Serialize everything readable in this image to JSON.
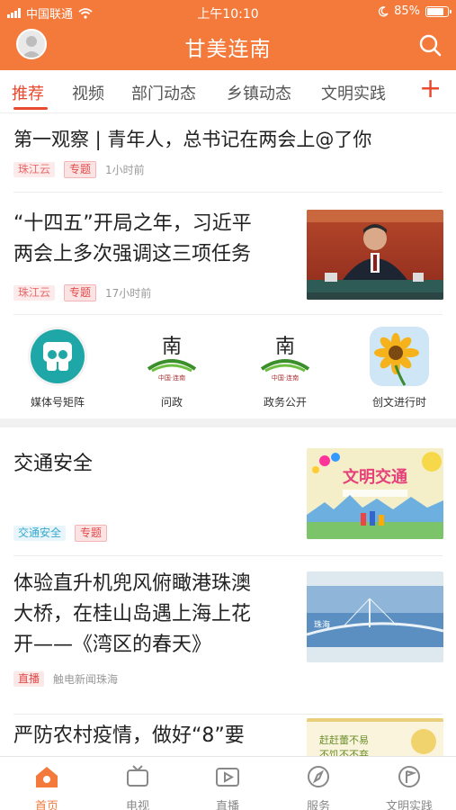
{
  "status": {
    "carrier": "中国联通",
    "time": "上午10:10",
    "battery": "85%",
    "battery_level": 0.85
  },
  "header": {
    "title": "甘美连南"
  },
  "tabs": [
    {
      "label": "推荐",
      "active": true
    },
    {
      "label": "视频"
    },
    {
      "label": "部门动态"
    },
    {
      "label": "乡镇动态"
    },
    {
      "label": "文明实践"
    }
  ],
  "tab_add": "+",
  "news": [
    {
      "title": "第一观察 | 青年人，总书记在两会上@了你",
      "source": "珠江云",
      "tag": "专题",
      "time": "1小时前"
    },
    {
      "title_lines": [
        "“十四五”开局之年，习近平",
        "两会上多次强调这三项任务"
      ],
      "source": "珠江云",
      "tag": "专题",
      "time": "17小时前"
    },
    {
      "title": "交通安全",
      "source": "交通安全",
      "tag": "专题"
    },
    {
      "title_lines": [
        "体验直升机兜风俯瞰港珠澳",
        "大桥，在桂山岛遇上海上花",
        "开——《湾区的春天》"
      ],
      "tag": "直播",
      "source": "触电新闻珠海"
    },
    {
      "title": "严防农村疫情，做好“8”要"
    }
  ],
  "thumb_text": {
    "civic_title": "文明交通",
    "bridge_label": "珠海",
    "epidemic_line1": "赶赶蕾不易",
    "epidemic_line2": "不饥不不弃",
    "emblem_char": "南",
    "emblem_sub": "中国·连南"
  },
  "shortcuts": [
    {
      "label": "媒体号矩阵",
      "icon": "media-matrix-icon"
    },
    {
      "label": "问政",
      "icon": "lianan-emblem-icon"
    },
    {
      "label": "政务公开",
      "icon": "lianan-emblem-icon"
    },
    {
      "label": "创文进行时",
      "icon": "sunflower-icon"
    }
  ],
  "bottom_nav": [
    {
      "label": "首页",
      "icon": "home-icon",
      "active": true
    },
    {
      "label": "电视",
      "icon": "tv-icon"
    },
    {
      "label": "直播",
      "icon": "live-icon"
    },
    {
      "label": "服务",
      "icon": "compass-icon"
    },
    {
      "label": "文明实践",
      "icon": "flag-icon"
    }
  ],
  "colors": {
    "brand": "#f47a3c",
    "accent_red": "#e8492f"
  }
}
